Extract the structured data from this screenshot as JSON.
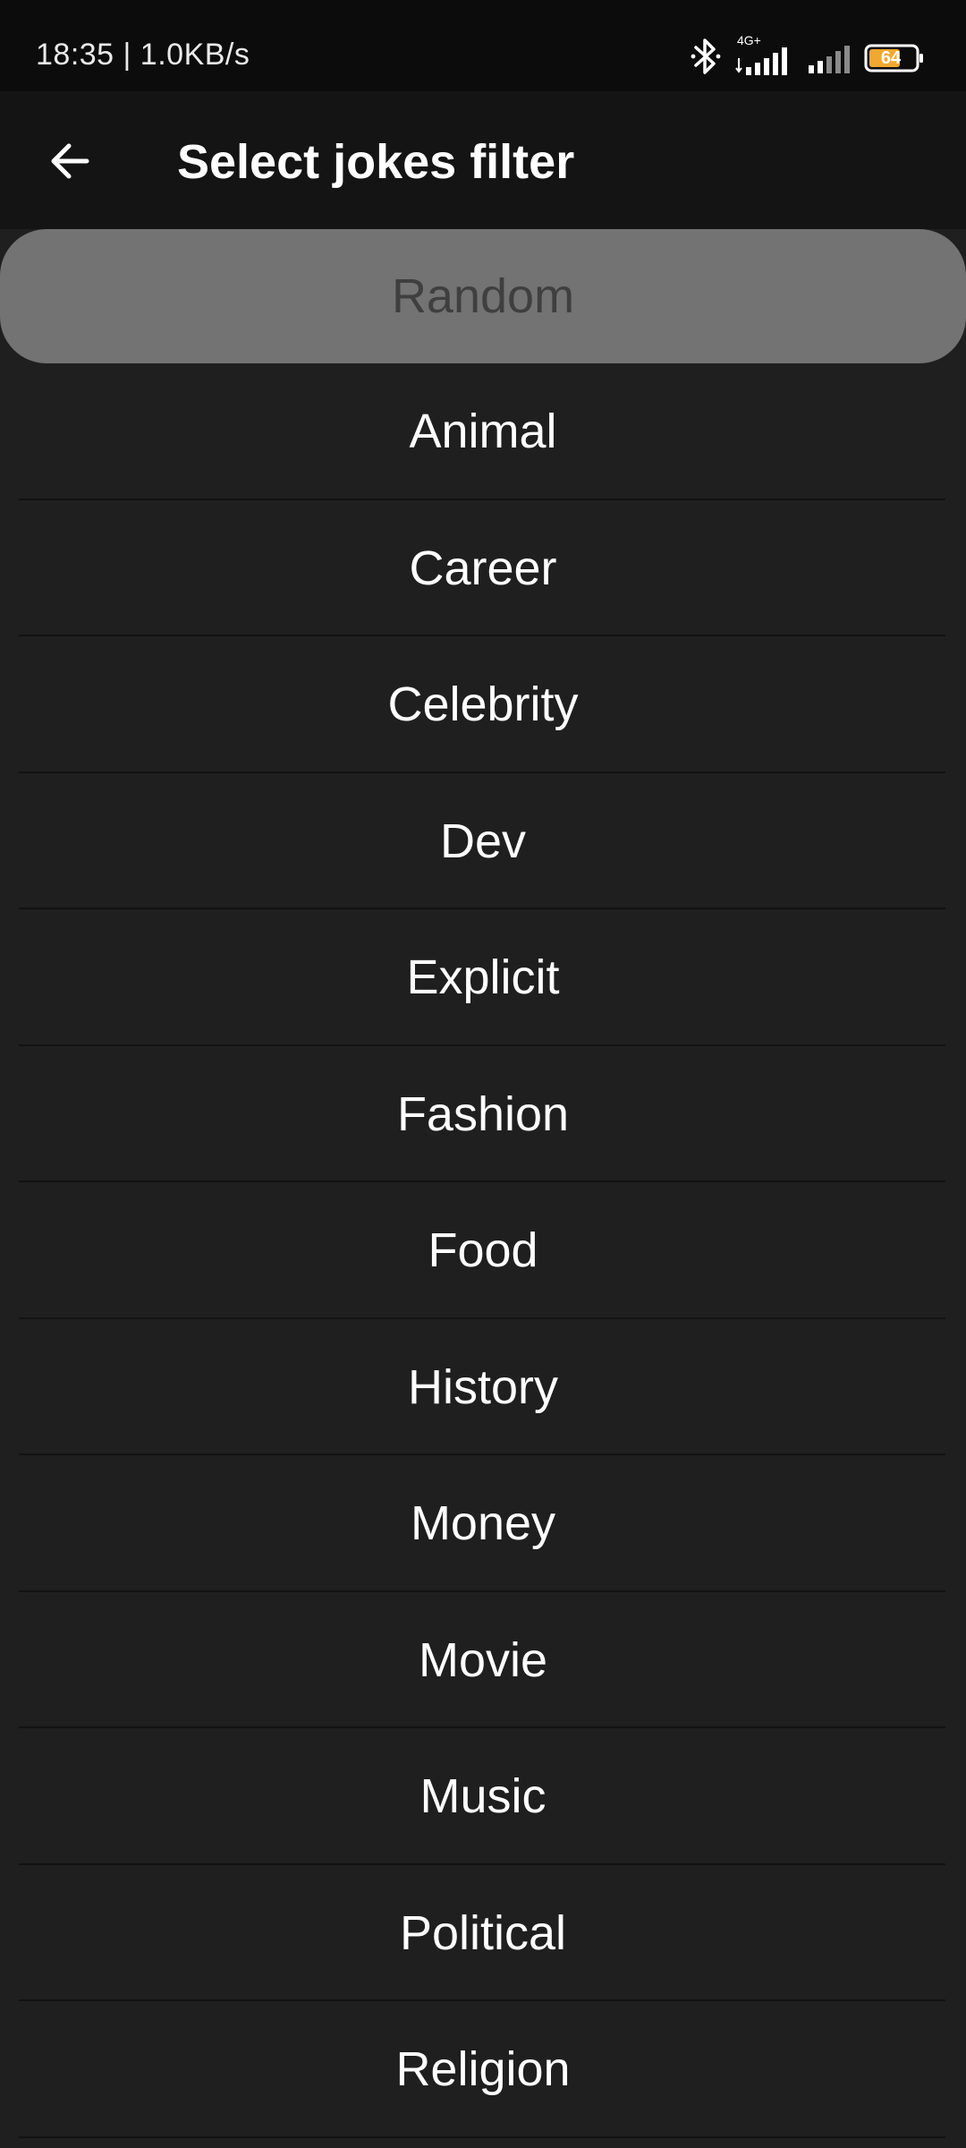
{
  "status_bar": {
    "text": "18:35 | 1.0KB/s",
    "network_label": "4G+",
    "battery_level": "64",
    "battery_color": "#f0a830",
    "icons": [
      "bluetooth-icon",
      "signal-4g-icon",
      "signal-icon",
      "battery-icon"
    ]
  },
  "header": {
    "back_icon": "arrow-left-icon",
    "title": "Select jokes filter"
  },
  "selected": {
    "label": "Random"
  },
  "items": [
    {
      "label": "Animal"
    },
    {
      "label": "Career"
    },
    {
      "label": "Celebrity"
    },
    {
      "label": "Dev"
    },
    {
      "label": "Explicit"
    },
    {
      "label": "Fashion"
    },
    {
      "label": "Food"
    },
    {
      "label": "History"
    },
    {
      "label": "Money"
    },
    {
      "label": "Movie"
    },
    {
      "label": "Music"
    },
    {
      "label": "Political"
    },
    {
      "label": "Religion"
    }
  ],
  "colors": {
    "background": "#1f1f1f",
    "app_bar": "#141414",
    "status_bar": "#0c0c0c",
    "selected_background": "#737373",
    "selected_text": "#3f3f3f",
    "text": "#ffffff"
  }
}
